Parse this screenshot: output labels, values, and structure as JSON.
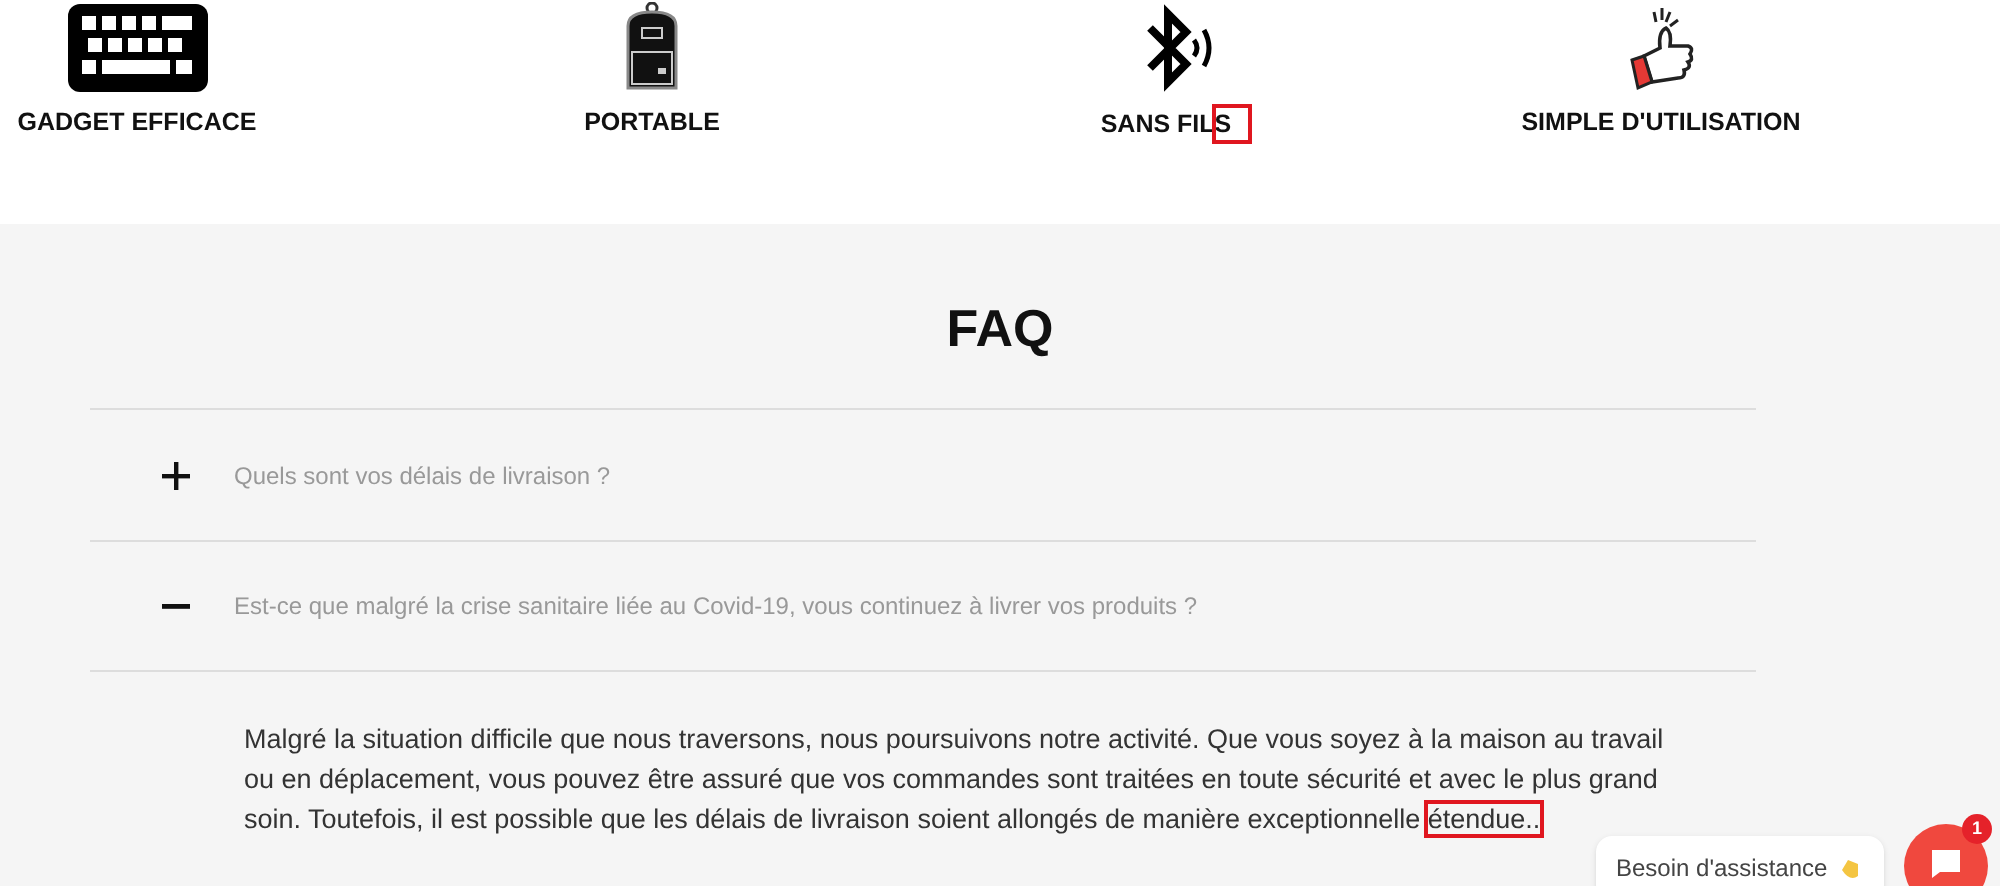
{
  "features": [
    {
      "kind": "keyboard",
      "label": "GADGET EFFICACE",
      "highlighted": false
    },
    {
      "kind": "backpack",
      "label": "PORTABLE",
      "highlighted": false
    },
    {
      "kind": "bluetooth",
      "label": "SANS FILS",
      "highlighted": true
    },
    {
      "kind": "thumbs",
      "label": "SIMPLE D'UTILISATION",
      "highlighted": false
    }
  ],
  "faq": {
    "title": "FAQ",
    "items": [
      {
        "question": "Quels sont vos délais de livraison ?",
        "expanded": false
      },
      {
        "question": "Est-ce que malgré la crise sanitaire liée au Covid-19, vous continuez à livrer vos produits ?",
        "expanded": true,
        "answer": "Malgré la situation difficile que nous traversons, nous poursuivons notre activité. Que vous soyez à la maison au travail ou en déplacement, vous pouvez être assuré que vos commandes sont traitées en toute sécurité et avec le plus grand soin. Toutefois, il est possible que les délais de livraison soient allongés de manière exceptionnelle étendue..",
        "last_word_highlighted": true
      }
    ]
  },
  "chat": {
    "label": "Besoin d'assistance",
    "badge": "1"
  }
}
